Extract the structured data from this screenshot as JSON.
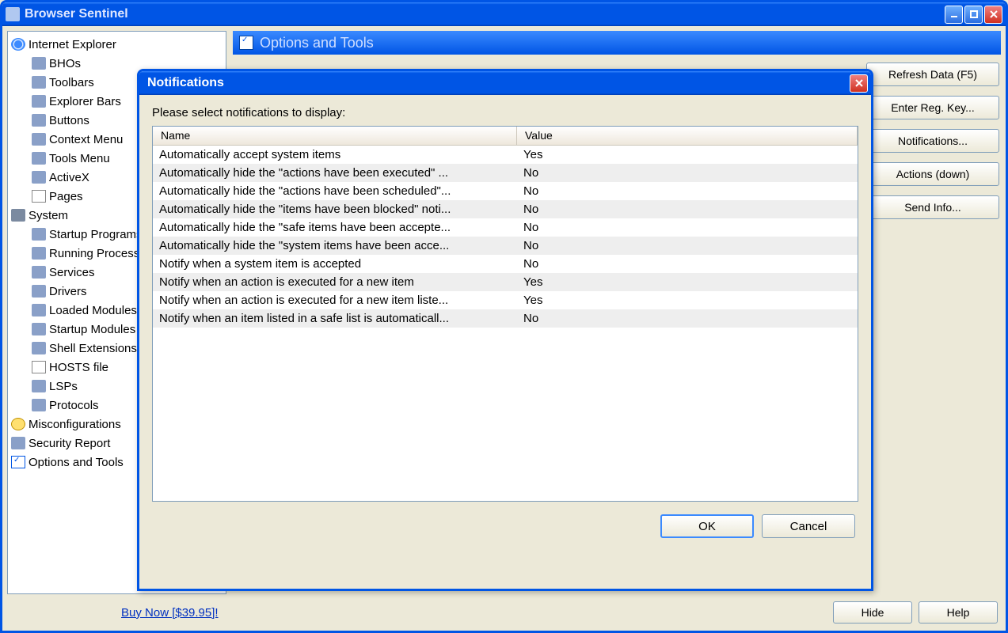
{
  "window": {
    "title": "Browser Sentinel"
  },
  "pane": {
    "title": "Options and Tools"
  },
  "tree": {
    "ie": {
      "label": "Internet Explorer",
      "children": [
        {
          "label": "BHOs"
        },
        {
          "label": "Toolbars"
        },
        {
          "label": "Explorer Bars"
        },
        {
          "label": "Buttons"
        },
        {
          "label": "Context Menu"
        },
        {
          "label": "Tools Menu"
        },
        {
          "label": "ActiveX"
        },
        {
          "label": "Pages"
        }
      ]
    },
    "system": {
      "label": "System",
      "children": [
        {
          "label": "Startup Programs"
        },
        {
          "label": "Running Processes"
        },
        {
          "label": "Services"
        },
        {
          "label": "Drivers"
        },
        {
          "label": "Loaded Modules"
        },
        {
          "label": "Startup Modules"
        },
        {
          "label": "Shell Extensions"
        },
        {
          "label": "HOSTS file"
        },
        {
          "label": "LSPs"
        },
        {
          "label": "Protocols"
        }
      ]
    },
    "misc": {
      "label": "Misconfigurations"
    },
    "secrep": {
      "label": "Security Report"
    },
    "options": {
      "label": "Options and Tools"
    }
  },
  "side_buttons": {
    "b0": "Refresh Data (F5)",
    "b1": "Enter Reg. Key...",
    "b2": "Notifications...",
    "b3": "Actions (down)",
    "b4": "Send Info..."
  },
  "footer": {
    "buy": "Buy Now [$39.95]!",
    "hide": "Hide",
    "help": "Help"
  },
  "dialog": {
    "title": "Notifications",
    "instruction": "Please select notifications to display:",
    "columns": {
      "name": "Name",
      "value": "Value"
    },
    "rows": [
      {
        "name": "Automatically accept system items",
        "value": "Yes"
      },
      {
        "name": "Automatically hide the \"actions have been executed\" ...",
        "value": "No"
      },
      {
        "name": "Automatically hide the \"actions have been scheduled\"...",
        "value": "No"
      },
      {
        "name": "Automatically hide the \"items have been blocked\" noti...",
        "value": "No"
      },
      {
        "name": "Automatically hide the \"safe items have been accepte...",
        "value": "No"
      },
      {
        "name": "Automatically hide the \"system items have been acce...",
        "value": "No"
      },
      {
        "name": "Notify when a system item is accepted",
        "value": "No"
      },
      {
        "name": "Notify when an action is executed for a new item",
        "value": "Yes"
      },
      {
        "name": "Notify when an action is executed for a new item liste...",
        "value": "Yes"
      },
      {
        "name": "Notify when an item listed in a safe list is automaticall...",
        "value": "No"
      }
    ],
    "ok": "OK",
    "cancel": "Cancel"
  }
}
